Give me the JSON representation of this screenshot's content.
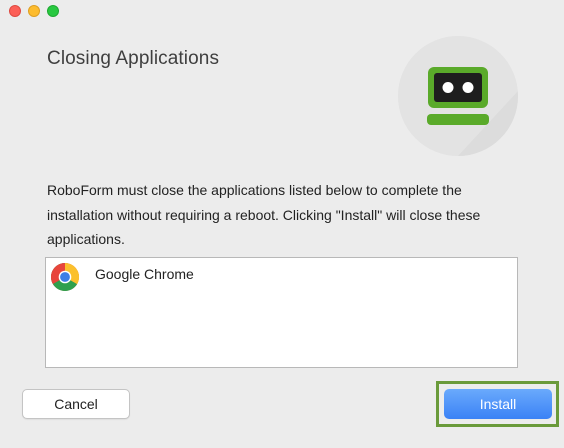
{
  "window": {
    "controls": [
      "close",
      "minimize",
      "zoom"
    ]
  },
  "dialog": {
    "title": "Closing Applications",
    "logo_icon": "roboform-robot-icon",
    "message": "RoboForm must close the applications listed below to complete the installation without requiring a reboot. Clicking \"Install\" will close these applications."
  },
  "app_list": {
    "items": [
      {
        "name": "Google Chrome",
        "icon": "chrome-icon"
      }
    ]
  },
  "buttons": {
    "cancel_label": "Cancel",
    "install_label": "Install"
  },
  "colors": {
    "logo_green": "#5aaa2a",
    "install_blue": "#4a8ef8",
    "highlight_green": "#6a9a3a"
  }
}
